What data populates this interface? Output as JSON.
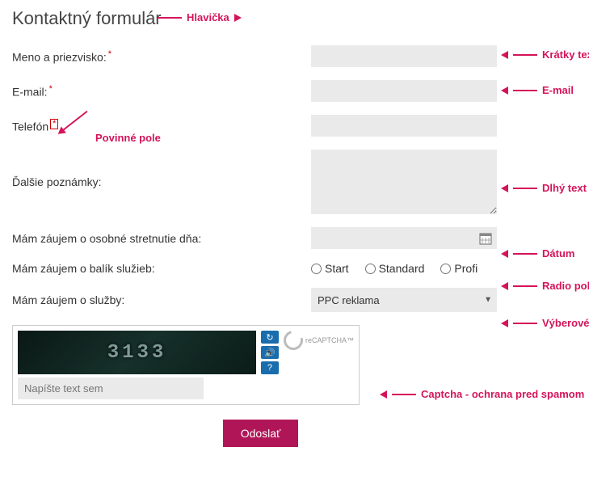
{
  "heading": "Kontaktný formulár",
  "fields": {
    "name_label": "Meno a priezvisko:",
    "email_label": "E-mail:",
    "phone_label": "Telefón",
    "notes_label": "Ďalšie poznámky:",
    "meeting_label": "Mám záujem o osobné stretnutie dňa:",
    "package_label": "Mám záujem o balík služieb:",
    "services_label": "Mám záujem o služby:"
  },
  "radios": {
    "opt1": "Start",
    "opt2": "Standard",
    "opt3": "Profi"
  },
  "select": {
    "value": "PPC reklama"
  },
  "captcha": {
    "code": "3133",
    "placeholder": "Napíšte text sem",
    "brand": "reCAPTCHA™"
  },
  "submit": "Odoslať",
  "annotations": {
    "header": "Hlavička",
    "short_text": "Krátky text",
    "email": "E-mail",
    "required": "Povinné pole",
    "long_text": "Dlhý text",
    "date": "Dátum",
    "radio": "Radio políčko",
    "select": "Výberové menu",
    "captcha": "Captcha - ochrana pred spamom"
  }
}
